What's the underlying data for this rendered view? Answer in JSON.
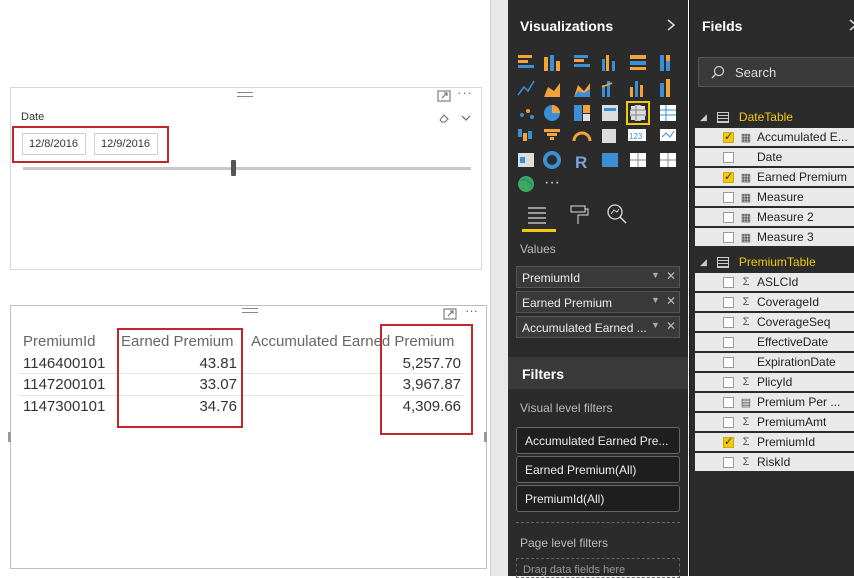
{
  "slicer": {
    "title": "Date",
    "start_date": "12/8/2016",
    "end_date": "12/9/2016"
  },
  "table": {
    "headers": [
      "PremiumId",
      "Earned Premium",
      "Accumulated Earned Premium"
    ],
    "rows": [
      {
        "premium_id": "1146400101",
        "earned": "43.81",
        "accumulated": "5,257.70"
      },
      {
        "premium_id": "1147200101",
        "earned": "33.07",
        "accumulated": "3,967.87"
      },
      {
        "premium_id": "1147300101",
        "earned": "34.76",
        "accumulated": "4,309.66"
      }
    ]
  },
  "visualizations": {
    "title": "Visualizations",
    "values_label": "Values",
    "wells": [
      "PremiumId",
      "Earned Premium",
      "Accumulated Earned ..."
    ],
    "more_label": "···"
  },
  "filters": {
    "title": "Filters",
    "visual_level_label": "Visual level filters",
    "cards": [
      "Accumulated Earned Pre...",
      "Earned Premium(All)",
      "PremiumId(All)"
    ],
    "page_level_label": "Page level filters",
    "drag_hint": "Drag data fields here"
  },
  "fields": {
    "title": "Fields",
    "search_placeholder": "Search",
    "tables": [
      {
        "name": "DateTable",
        "fields": [
          {
            "name": "Accumulated E...",
            "checked": true,
            "type": "calc"
          },
          {
            "name": "Date",
            "checked": false,
            "type": "none"
          },
          {
            "name": "Earned Premium",
            "checked": true,
            "type": "calc"
          },
          {
            "name": "Measure",
            "checked": false,
            "type": "calc"
          },
          {
            "name": "Measure 2",
            "checked": false,
            "type": "calc"
          },
          {
            "name": "Measure 3",
            "checked": false,
            "type": "calc"
          }
        ]
      },
      {
        "name": "PremiumTable",
        "fields": [
          {
            "name": "ASLCId",
            "checked": false,
            "type": "sum"
          },
          {
            "name": "CoverageId",
            "checked": false,
            "type": "sum"
          },
          {
            "name": "CoverageSeq",
            "checked": false,
            "type": "sum"
          },
          {
            "name": "EffectiveDate",
            "checked": false,
            "type": "none"
          },
          {
            "name": "ExpirationDate",
            "checked": false,
            "type": "none"
          },
          {
            "name": "PlicyId",
            "checked": false,
            "type": "sum"
          },
          {
            "name": "Premium Per ...",
            "checked": false,
            "type": "calctable"
          },
          {
            "name": "PremiumAmt",
            "checked": false,
            "type": "sum"
          },
          {
            "name": "PremiumId",
            "checked": true,
            "type": "sum"
          },
          {
            "name": "RiskId",
            "checked": false,
            "type": "sum"
          }
        ]
      }
    ]
  },
  "colors": {
    "accent_yellow": "#f2c811",
    "highlight_red": "#c0262c",
    "pane_bg": "#2b2b2b"
  }
}
